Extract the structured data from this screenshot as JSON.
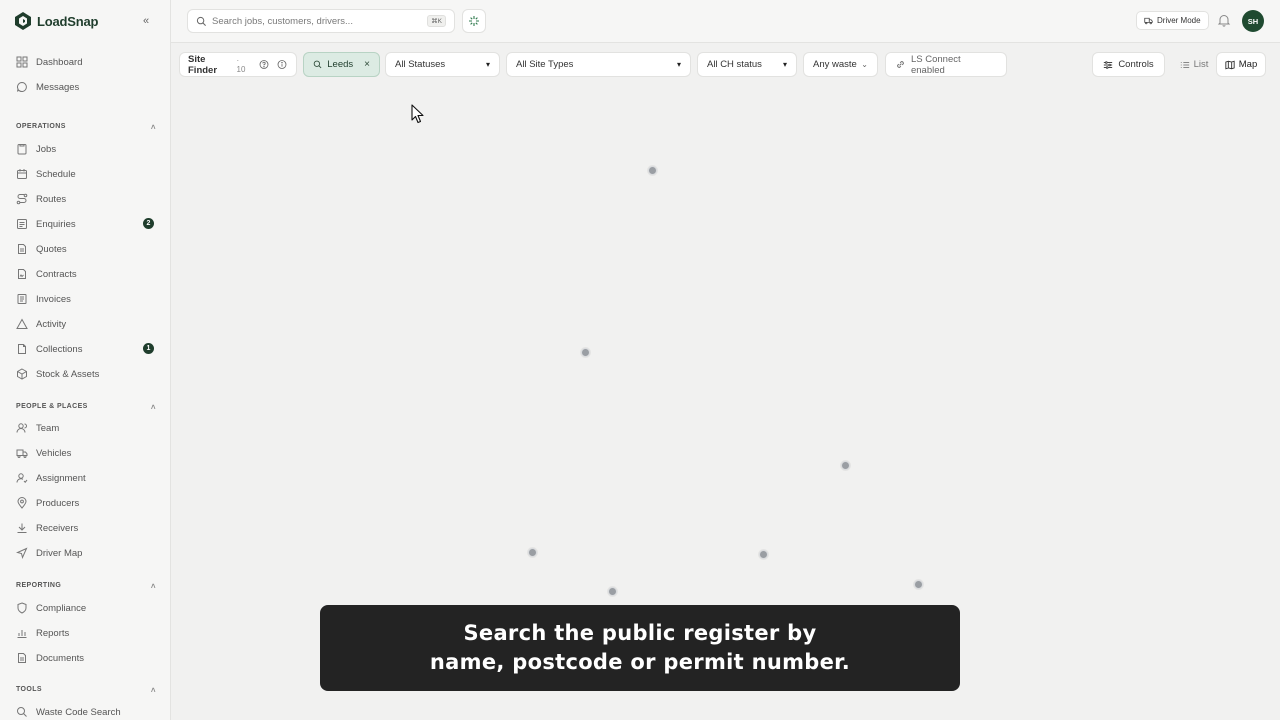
{
  "app": {
    "name": "LoadSnap",
    "brand_color": "#1f3d2c",
    "accent_chip_bg": "#dcebe3"
  },
  "sidebar": {
    "top_items": [
      {
        "label": "Dashboard",
        "icon": "dashboard-icon"
      },
      {
        "label": "Messages",
        "icon": "messages-icon"
      }
    ],
    "sections": [
      {
        "title": "OPERATIONS",
        "items": [
          {
            "label": "Jobs",
            "icon": "jobs-icon"
          },
          {
            "label": "Schedule",
            "icon": "calendar-icon"
          },
          {
            "label": "Routes",
            "icon": "routes-icon"
          },
          {
            "label": "Enquiries",
            "icon": "enquiries-icon",
            "badge": "2"
          },
          {
            "label": "Quotes",
            "icon": "quotes-icon"
          },
          {
            "label": "Contracts",
            "icon": "contracts-icon"
          },
          {
            "label": "Invoices",
            "icon": "invoices-icon"
          },
          {
            "label": "Activity",
            "icon": "activity-icon"
          },
          {
            "label": "Collections",
            "icon": "collections-icon",
            "badge": "1"
          },
          {
            "label": "Stock & Assets",
            "icon": "box-icon"
          }
        ]
      },
      {
        "title": "PEOPLE & PLACES",
        "items": [
          {
            "label": "Team",
            "icon": "team-icon"
          },
          {
            "label": "Vehicles",
            "icon": "truck-icon"
          },
          {
            "label": "Assignment",
            "icon": "assignment-icon"
          },
          {
            "label": "Producers",
            "icon": "pin-icon"
          },
          {
            "label": "Receivers",
            "icon": "download-icon"
          },
          {
            "label": "Driver Map",
            "icon": "navigation-icon"
          }
        ]
      },
      {
        "title": "REPORTING",
        "items": [
          {
            "label": "Compliance",
            "icon": "shield-icon"
          },
          {
            "label": "Reports",
            "icon": "bar-chart-icon"
          },
          {
            "label": "Documents",
            "icon": "document-icon"
          }
        ]
      },
      {
        "title": "TOOLS",
        "items": [
          {
            "label": "Waste Code Search",
            "icon": "search-icon"
          }
        ]
      }
    ]
  },
  "topbar": {
    "search_placeholder": "Search jobs, customers, drivers...",
    "shortcut": "⌘K",
    "driver_mode_label": "Driver Mode",
    "avatar_initials": "SH"
  },
  "filters": {
    "site_finder_label": "Site Finder",
    "site_finder_count": "· 10",
    "search_chip": "Leeds",
    "status_select": {
      "selected": "All Statuses",
      "options": [
        "All Statuses"
      ]
    },
    "site_type_select": {
      "selected": "All Site Types",
      "options": [
        "All Site Types"
      ]
    },
    "ch_status_select": {
      "selected": "All CH status",
      "options": [
        "All CH status"
      ]
    },
    "waste_dropdown": "Any waste",
    "ls_connect_label": "LS Connect enabled",
    "controls_label": "Controls",
    "view_list_label": "List",
    "view_map_label": "Map"
  },
  "caption": {
    "line1": "Search the public register by",
    "line2": "name, postcode or permit number."
  }
}
